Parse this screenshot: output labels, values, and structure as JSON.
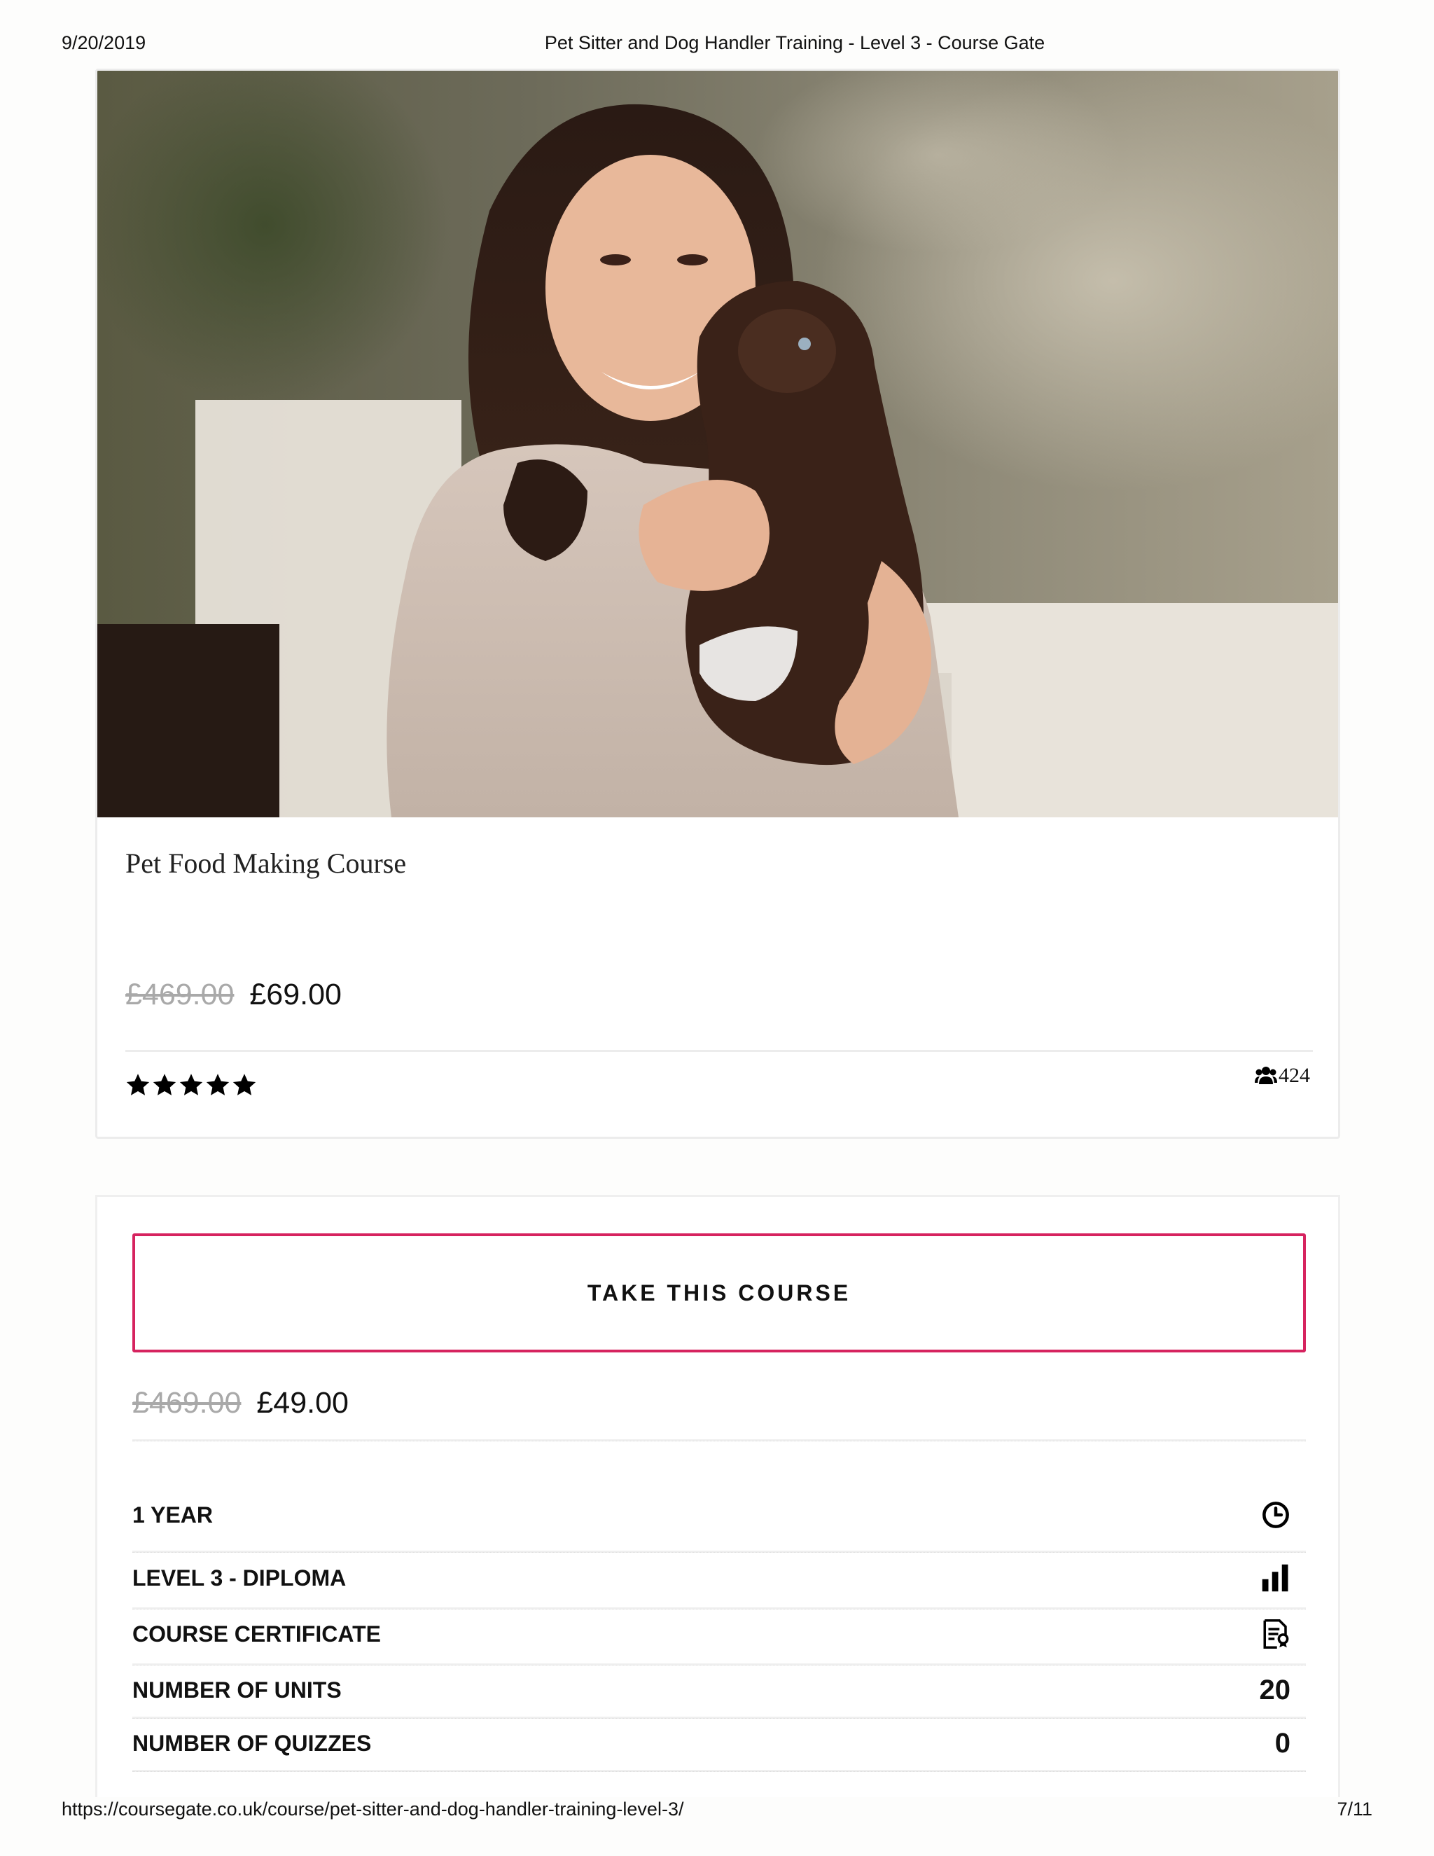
{
  "print_header": {
    "date": "9/20/2019",
    "title": "Pet Sitter and Dog Handler Training - Level 3 - Course Gate"
  },
  "course_card": {
    "image_alt": "Woman hugging a brown puppy",
    "title": "Pet Food Making Course",
    "old_price": "£469.00",
    "new_price": "£69.00",
    "rating_stars": 5,
    "students_icon": "users-icon",
    "students_count": "424"
  },
  "course_panel": {
    "button_label": "TAKE THIS COURSE",
    "old_price": "£469.00",
    "new_price": "£49.00",
    "details": [
      {
        "label": "1 YEAR",
        "icon": "clock-icon"
      },
      {
        "label": "LEVEL 3 - DIPLOMA",
        "icon": "bar-chart-icon"
      },
      {
        "label": "COURSE CERTIFICATE",
        "icon": "certificate-icon"
      },
      {
        "label": "NUMBER OF UNITS",
        "value": "20"
      },
      {
        "label": "NUMBER OF QUIZZES",
        "value": "0"
      }
    ]
  },
  "colors": {
    "accent": "#d6235f",
    "strike_price": "#a9a9a9",
    "border": "#ececec"
  },
  "print_footer": {
    "url": "https://coursegate.co.uk/course/pet-sitter-and-dog-handler-training-level-3/",
    "page": "7/11"
  }
}
